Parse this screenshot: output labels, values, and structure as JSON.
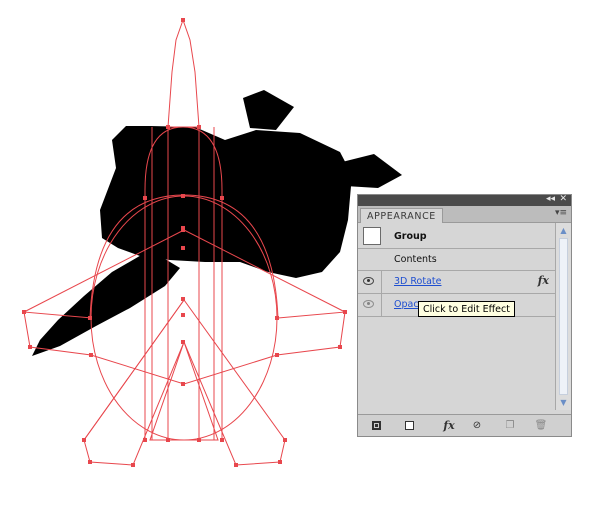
{
  "panel": {
    "tab_label": "APPEARANCE",
    "collapse_glyph": "◂◂",
    "close_glyph": "✕",
    "menu_glyph": "▾≡",
    "group_label": "Group",
    "contents_label": "Contents",
    "effects": [
      {
        "label": "3D Rotate",
        "fx_glyph": "fx"
      },
      {
        "label": "Opac",
        "fx_glyph": ""
      }
    ],
    "tooltip": "Click to Edit Effect",
    "scroll_up_glyph": "▲",
    "scroll_down_glyph": "▼",
    "bottom_buttons": {
      "fx": "fx",
      "clear": "⊘",
      "duplicate": "❐",
      "delete": "🗑"
    }
  },
  "colors": {
    "silhouette": "#000000",
    "guide_lines": "#e8474d",
    "link_blue": "#1f4fd0",
    "panel_bg": "#d6d6d6",
    "tooltip_bg": "#ffffe1"
  },
  "icons": [
    "eye-icon",
    "fx-icon",
    "new-stroke-icon",
    "new-fill-icon",
    "clear-appearance-icon",
    "duplicate-item-icon",
    "delete-item-icon"
  ]
}
